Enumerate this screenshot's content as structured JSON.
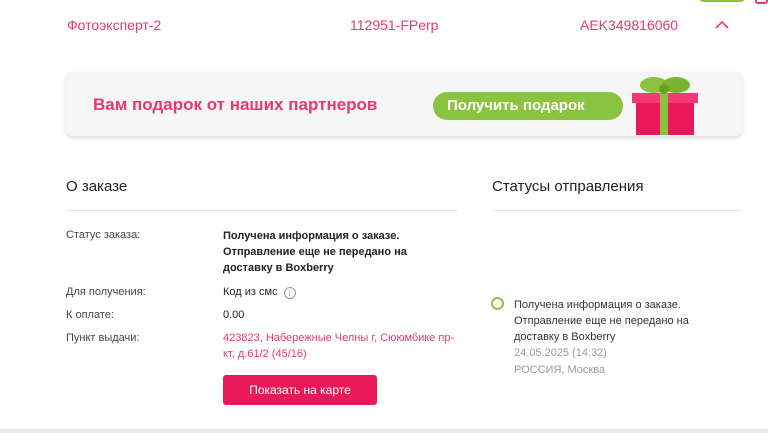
{
  "shipment_row": {
    "shop": "Фотоэксперт-2",
    "order_number": "112951-FPerp",
    "tracking": "AEK349816060"
  },
  "gift_banner": {
    "text": "Вам подарок от наших партнеров",
    "button_label": "Получить подарок"
  },
  "order": {
    "title": "О заказе",
    "status_label": "Статус заказа:",
    "status_value": "Получена информация о заказе. Отправление еще не передано на доставку в Boxberry",
    "receive_label": "Для получения:",
    "receive_value": "Код из смс",
    "payment_label": "К оплате:",
    "payment_value": "0.00",
    "pickup_label": "Пункт выдачи:",
    "pickup_value": "423823, Набережные Челны г, Сююмбике пр-кт, д.61/2 (45/16)",
    "map_button": "Показать на карте"
  },
  "statuses": {
    "title": "Статусы отправления",
    "items": [
      {
        "text": "Получена информация о заказе. Отправление еще не передано на доставку в Boxberry",
        "date": "24.05.2025 (14:32)",
        "location": "РОССИЯ, Москва"
      }
    ]
  },
  "colors": {
    "accent": "#e8396b",
    "button": "#e8185b",
    "green": "#8ac33d"
  }
}
